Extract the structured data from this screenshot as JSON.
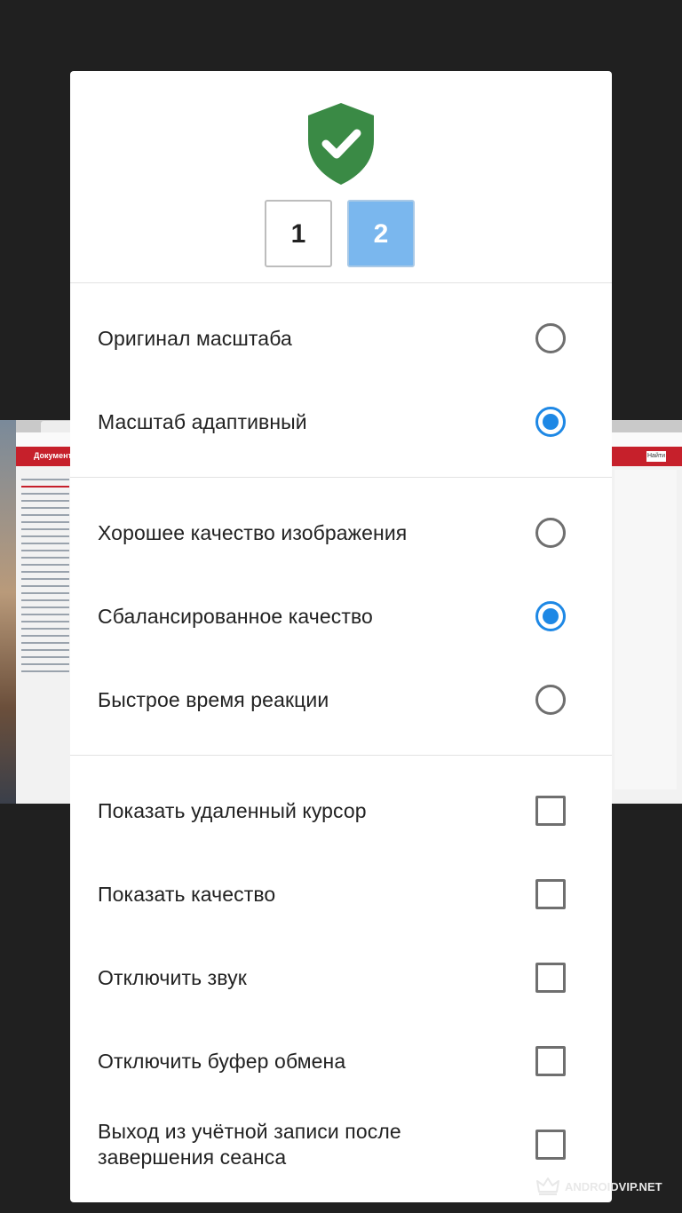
{
  "background": {
    "window_title": "Документа",
    "search_button": "Найти"
  },
  "monitors": {
    "items": [
      {
        "label": "1",
        "selected": false
      },
      {
        "label": "2",
        "selected": true
      }
    ]
  },
  "scale_options": [
    {
      "label": "Оригинал масштаба",
      "selected": false
    },
    {
      "label": "Масштаб адаптивный",
      "selected": true
    }
  ],
  "quality_options": [
    {
      "label": "Хорошее качество изображения",
      "selected": false
    },
    {
      "label": "Сбалансированное качество",
      "selected": true
    },
    {
      "label": "Быстрое время реакции",
      "selected": false
    }
  ],
  "toggles": [
    {
      "label": "Показать удаленный курсор",
      "checked": false
    },
    {
      "label": "Показать качество",
      "checked": false
    },
    {
      "label": "Отключить звук",
      "checked": false
    },
    {
      "label": "Отключить буфер обмена",
      "checked": false
    },
    {
      "label": "Выход из учётной записи после завершения сеанса",
      "checked": false
    }
  ],
  "watermark": "ANDROIDVIP.NET",
  "colors": {
    "shield": "#3a8a45",
    "radio_active": "#1e88e5",
    "monitor_selected": "#7ab7ee"
  }
}
